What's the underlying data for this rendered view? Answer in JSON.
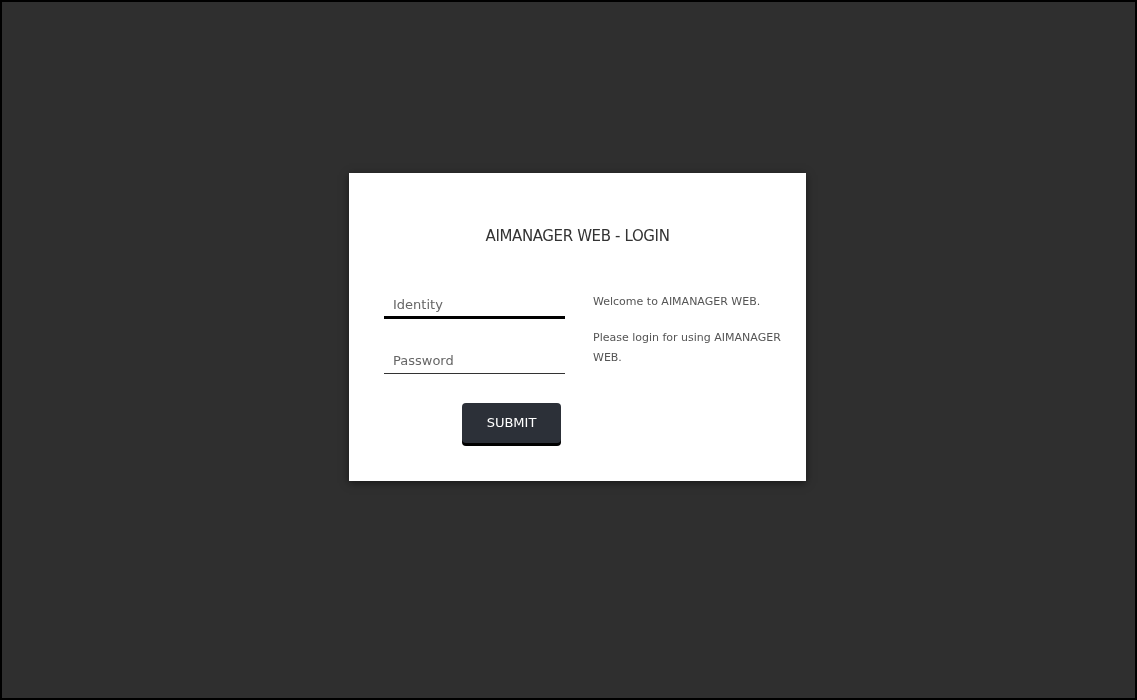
{
  "title": "AIMANAGER WEB - LOGIN",
  "fields": [
    {
      "placeholder": "Identity",
      "focused": true
    },
    {
      "placeholder": "Password",
      "focused": false
    }
  ],
  "submit": "SUBMIT",
  "messages": [
    "Welcome to AIMANAGER WEB.",
    "Please login for using AIMANAGER WEB."
  ]
}
